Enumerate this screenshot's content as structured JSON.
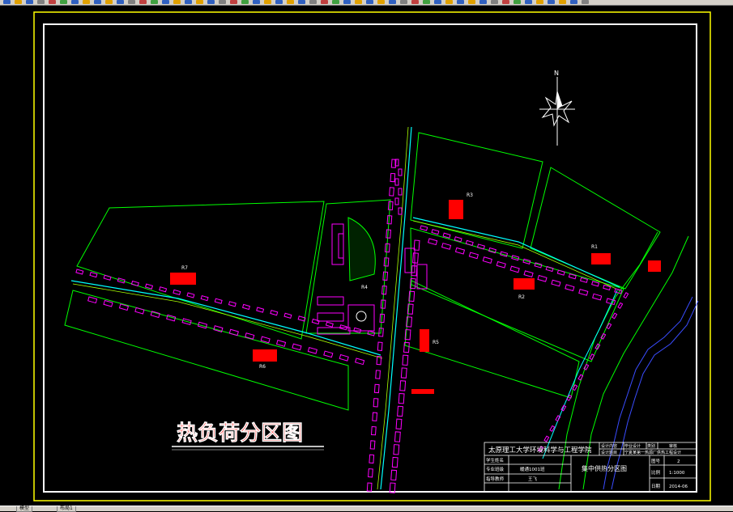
{
  "drawing": {
    "title": "热负荷分区图",
    "north_label": "N",
    "zones": [
      {
        "id": "R1",
        "label": "R1"
      },
      {
        "id": "R2",
        "label": "R2"
      },
      {
        "id": "R3",
        "label": "R3"
      },
      {
        "id": "R4",
        "label": "R4"
      },
      {
        "id": "R5",
        "label": "R5"
      },
      {
        "id": "R6",
        "label": "R6"
      },
      {
        "id": "R7",
        "label": "R7"
      }
    ]
  },
  "title_block": {
    "university": "太原理工大学环境科学与工程学院",
    "drawing_name": "集中供热分区图",
    "cells": {
      "design_content": "设计内容",
      "graduation_design": "毕业设计",
      "category": "类别",
      "review": "审核",
      "design_topic": "设计题目",
      "topic_value": "宁夏某第一热源厂供热工程设计",
      "major_class": "专业班级",
      "class_value": "暖通1001班",
      "student_name": "学生姓名",
      "name_value": "王飞",
      "instructor": "指导教师",
      "drawing_no_label": "图号",
      "drawing_no": "2",
      "scale_label": "比例",
      "scale": "1:1000",
      "date_label": "日期",
      "date": "2014-06"
    }
  },
  "statusbar": {
    "tabs": [
      "模型",
      "布局1"
    ]
  },
  "colors": {
    "background": "#000000",
    "border": "#ffffff",
    "viewport": "#ffff00",
    "boundary": "#00ff00",
    "building": "#ff00ff",
    "pipe": "#00ffff",
    "label": "#ff0000"
  }
}
